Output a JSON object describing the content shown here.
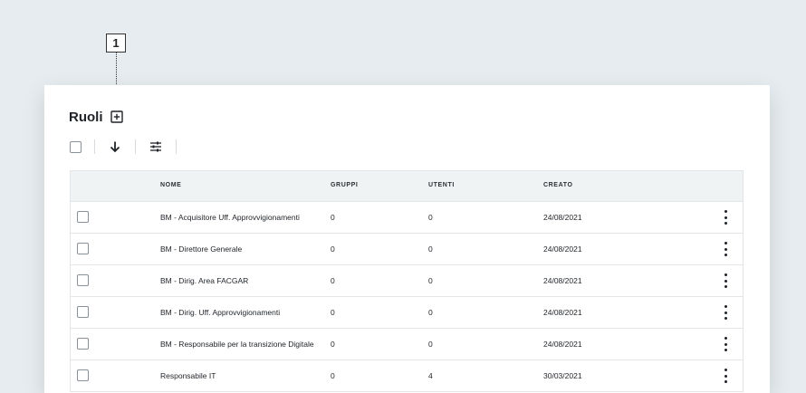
{
  "callout": {
    "label": "1"
  },
  "page": {
    "title": "Ruoli"
  },
  "icons": {
    "add": "plus-square-icon",
    "sort": "arrow-down-icon",
    "filter": "sliders-icon",
    "row_menu": "more-vertical-icon"
  },
  "table": {
    "columns": [
      "NOME",
      "GRUPPI",
      "UTENTI",
      "CREATO"
    ],
    "rows": [
      {
        "nome": "BM - Acquisitore Uff. Approvvigionamenti",
        "gruppi": "0",
        "utenti": "0",
        "creato": "24/08/2021"
      },
      {
        "nome": "BM - Direttore Generale",
        "gruppi": "0",
        "utenti": "0",
        "creato": "24/08/2021"
      },
      {
        "nome": "BM - Dirig. Area FACGAR",
        "gruppi": "0",
        "utenti": "0",
        "creato": "24/08/2021"
      },
      {
        "nome": "BM - Dirig. Uff. Approvvigionamenti",
        "gruppi": "0",
        "utenti": "0",
        "creato": "24/08/2021"
      },
      {
        "nome": "BM - Responsabile per la transizione Digitale",
        "gruppi": "0",
        "utenti": "0",
        "creato": "24/08/2021"
      },
      {
        "nome": "Responsabile IT",
        "gruppi": "0",
        "utenti": "4",
        "creato": "30/03/2021"
      }
    ]
  }
}
